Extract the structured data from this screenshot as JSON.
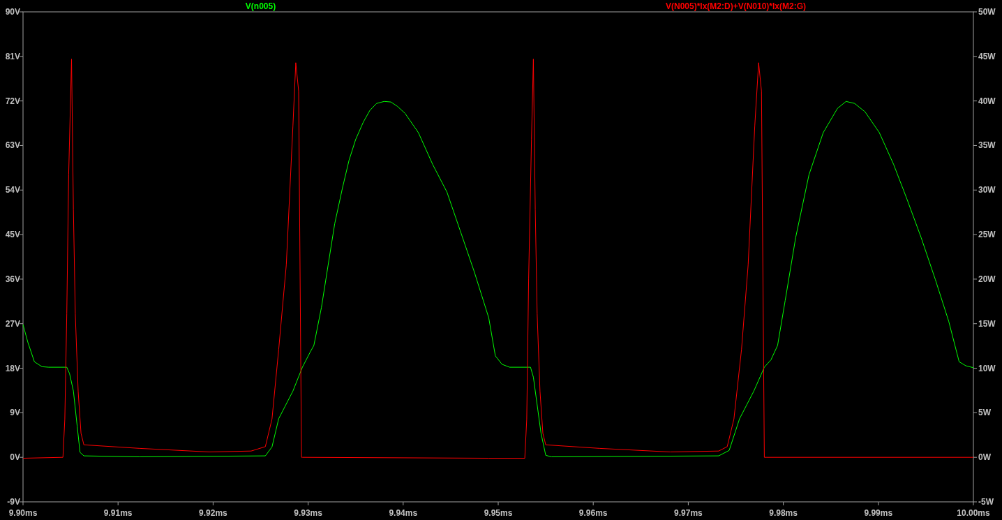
{
  "plot": {
    "chart_data": {
      "type": "line",
      "xlim": [
        9.9,
        10.0
      ],
      "xticks": [
        {
          "value": 9.9,
          "label": "9.90ms"
        },
        {
          "value": 9.91,
          "label": "9.91ms"
        },
        {
          "value": 9.92,
          "label": "9.92ms"
        },
        {
          "value": 9.93,
          "label": "9.93ms"
        },
        {
          "value": 9.94,
          "label": "9.94ms"
        },
        {
          "value": 9.95,
          "label": "9.95ms"
        },
        {
          "value": 9.96,
          "label": "9.96ms"
        },
        {
          "value": 9.97,
          "label": "9.97ms"
        },
        {
          "value": 9.98,
          "label": "9.98ms"
        },
        {
          "value": 9.99,
          "label": "9.99ms"
        },
        {
          "value": 10.0,
          "label": "10.00ms"
        }
      ],
      "ylim": [
        -9,
        90
      ],
      "yticks": [
        {
          "value": 90,
          "label": "90V"
        },
        {
          "value": 81,
          "label": "81V"
        },
        {
          "value": 72,
          "label": "72V"
        },
        {
          "value": 63,
          "label": "63V"
        },
        {
          "value": 54,
          "label": "54V"
        },
        {
          "value": 45,
          "label": "45V"
        },
        {
          "value": 36,
          "label": "36V"
        },
        {
          "value": 27,
          "label": "27V"
        },
        {
          "value": 18,
          "label": "18V"
        },
        {
          "value": 9,
          "label": "9V"
        },
        {
          "value": 0,
          "label": "0V"
        },
        {
          "value": -9,
          "label": "-9V"
        }
      ],
      "y2lim": [
        -5,
        50
      ],
      "y2ticks": [
        {
          "value": 50,
          "label": "50W"
        },
        {
          "value": 45,
          "label": "45W"
        },
        {
          "value": 40,
          "label": "40W"
        },
        {
          "value": 35,
          "label": "35W"
        },
        {
          "value": 30,
          "label": "30W"
        },
        {
          "value": 25,
          "label": "25W"
        },
        {
          "value": 20,
          "label": "20W"
        },
        {
          "value": 15,
          "label": "15W"
        },
        {
          "value": 10,
          "label": "10W"
        },
        {
          "value": 5,
          "label": "5W"
        },
        {
          "value": 0,
          "label": "0W"
        },
        {
          "value": -5,
          "label": "-5W"
        }
      ],
      "series": [
        {
          "name": "V(n005)",
          "color": "#00ff00",
          "x": [
            9.9,
            9.9005,
            9.9012,
            9.902,
            9.9027,
            9.9046,
            9.9049,
            9.9053,
            9.9057,
            9.906,
            9.9064,
            9.9123,
            9.9255,
            9.9262,
            9.9269,
            9.9284,
            9.9294,
            9.9302,
            9.9306,
            9.9314,
            9.9321,
            9.9328,
            9.9336,
            9.9343,
            9.935,
            9.9358,
            9.9365,
            9.9372,
            9.938,
            9.9387,
            9.9394,
            9.9402,
            9.9416,
            9.9431,
            9.9446,
            9.946,
            9.9475,
            9.949,
            9.9497,
            9.9504,
            9.9512,
            9.9534,
            9.9537,
            9.9541,
            9.9545,
            9.955,
            9.9556,
            9.9732,
            9.9743,
            9.9754,
            9.9769,
            9.978,
            9.9787,
            9.9794,
            9.9802,
            9.9813,
            9.9827,
            9.9842,
            9.9857,
            9.9866,
            9.9875,
            9.9886,
            9.9901,
            9.9916,
            9.993,
            9.9945,
            9.996,
            9.9974,
            9.9985,
            9.9992,
            10.0
          ],
          "values": [
            26.8,
            23.3,
            19.3,
            18.3,
            18.2,
            18.2,
            16.9,
            13.4,
            6.3,
            1.0,
            0.3,
            0.1,
            0.3,
            2.1,
            7.8,
            13.4,
            18.2,
            21.2,
            22.6,
            30.3,
            38.8,
            47.2,
            54.3,
            60.0,
            64.2,
            67.7,
            70.1,
            71.5,
            71.9,
            71.8,
            70.9,
            69.5,
            65.6,
            59.2,
            53.6,
            45.8,
            37.4,
            28.2,
            20.5,
            18.8,
            18.2,
            18.2,
            16.2,
            10.6,
            4.9,
            0.4,
            0.1,
            0.3,
            1.4,
            7.8,
            13.4,
            18.2,
            19.7,
            22.6,
            31.7,
            44.4,
            57.1,
            65.6,
            70.5,
            71.9,
            71.5,
            69.8,
            65.6,
            59.2,
            52.2,
            44.4,
            35.9,
            27.5,
            19.3,
            18.5,
            18.1
          ]
        },
        {
          "name": "V(N005)*Ix(M2:D)+V(N010)*Ix(M2:G)",
          "color": "#ff0000",
          "axis": "y2",
          "x": [
            9.9,
            9.9042,
            9.9044,
            9.9046,
            9.9048,
            9.9051,
            9.9053,
            9.9055,
            9.9058,
            9.9061,
            9.9064,
            9.9123,
            9.9196,
            9.924,
            9.9255,
            9.9262,
            9.9269,
            9.9277,
            9.9284,
            9.9287,
            9.929,
            9.9293,
            9.9294,
            9.949,
            9.9528,
            9.953,
            9.9532,
            9.9535,
            9.9537,
            9.9539,
            9.9541,
            9.9544,
            9.9547,
            9.955,
            9.9607,
            9.9681,
            9.9732,
            9.9741,
            9.9748,
            9.9756,
            9.9763,
            9.977,
            9.9774,
            9.9777,
            9.978,
            9.9782,
            10.0
          ],
          "values": [
            -0.1,
            0,
            4.3,
            16.1,
            31.7,
            44.7,
            27.8,
            16.1,
            7.4,
            2.7,
            1.4,
            1.0,
            0.6,
            0.7,
            1.2,
            4.3,
            12.1,
            21.6,
            37.2,
            44.3,
            41.1,
            0,
            0,
            -0.1,
            -0.1,
            4.3,
            20.0,
            35.7,
            44.7,
            27.8,
            16.1,
            7.4,
            2.7,
            1.4,
            1.0,
            0.6,
            0.7,
            1.2,
            4.3,
            12.1,
            21.6,
            37.2,
            44.3,
            41.1,
            0,
            0,
            0
          ]
        }
      ]
    }
  }
}
